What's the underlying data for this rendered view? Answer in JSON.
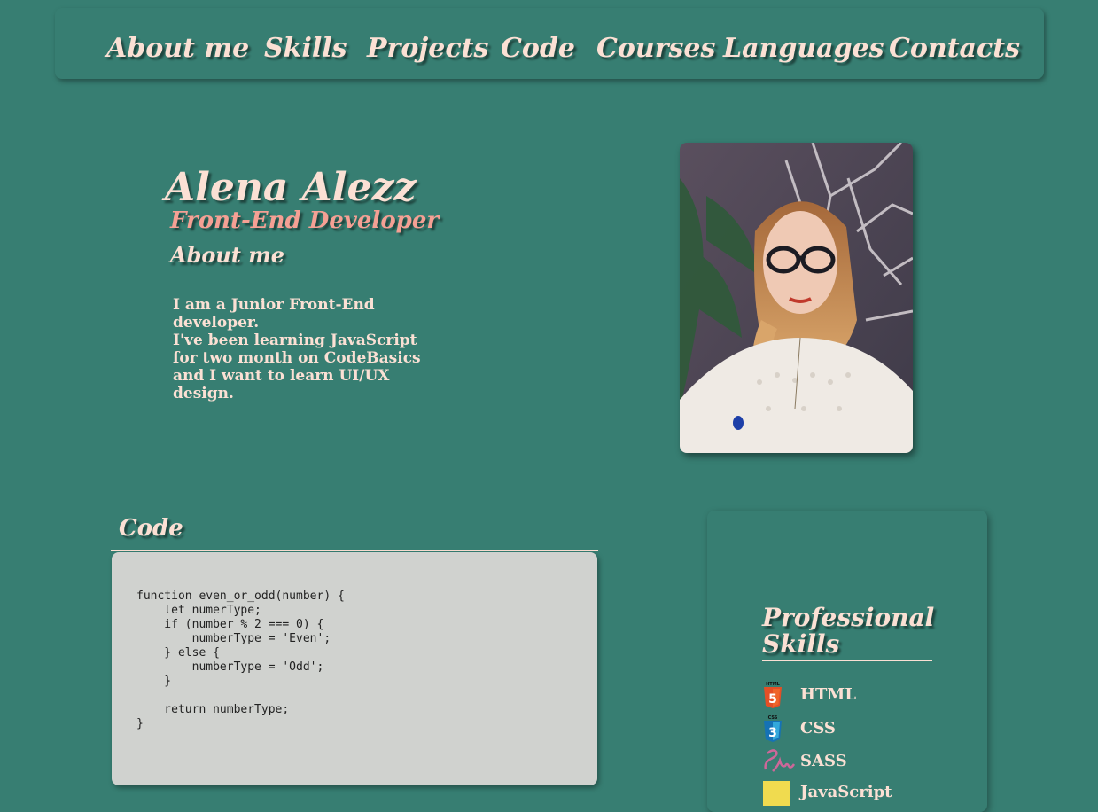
{
  "nav": {
    "items": [
      "About me",
      "Skills",
      "Projects",
      "Code",
      "Courses",
      "Languages",
      "Contacts"
    ]
  },
  "hero": {
    "name": "Alena Alezz",
    "role": "Front-End Developer",
    "about_heading": "About me",
    "about_lines": [
      "I am a Junior Front-End developer.",
      "I've been learning JavaScript for two month on CodeBasics and I want to learn UI/UX design."
    ],
    "photo_alt": "portrait photo"
  },
  "code": {
    "heading": "Code",
    "snippet": "function even_or_odd(number) {\n    let numerType;\n    if (number % 2 === 0) {\n        numberType = 'Even';\n    } else {\n        numberType = 'Odd';\n    }\n\n    return numberType;\n}"
  },
  "skills": {
    "heading": "Professional Skills",
    "items": [
      {
        "label": "HTML",
        "icon": "html5-icon"
      },
      {
        "label": "CSS",
        "icon": "css3-icon"
      },
      {
        "label": "SASS",
        "icon": "sass-icon"
      },
      {
        "label": "JavaScript",
        "icon": "javascript-icon"
      }
    ]
  },
  "colors": {
    "background": "#377e72",
    "text_light": "#fbe0d4",
    "accent_pink": "#f5a094",
    "code_bg": "#d0d2cf"
  }
}
